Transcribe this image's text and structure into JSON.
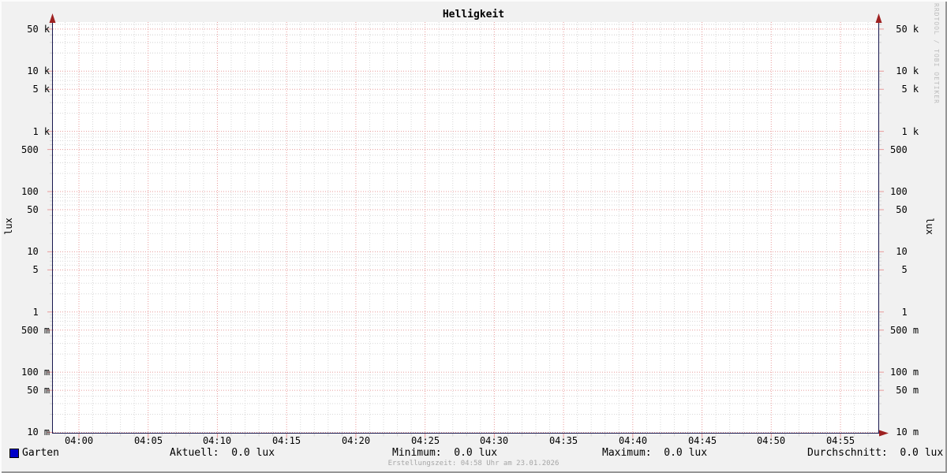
{
  "title": "Helligkeit",
  "watermark": "RRDTOOL / TOBI OETIKER",
  "footer": "Erstellungszeit: 04:58 Uhr am 23.01.2026",
  "y_axis_label": "lux",
  "legend": {
    "series": {
      "label": "Garten",
      "color": "#0000c8"
    },
    "stats": [
      {
        "label": "Aktuell:",
        "value": "0.0 lux"
      },
      {
        "label": "Minimum:",
        "value": "0.0 lux"
      },
      {
        "label": "Maximum:",
        "value": "0.0 lux"
      },
      {
        "label": "Durchschnitt:",
        "value": "0.0 lux"
      }
    ]
  },
  "chart_data": {
    "type": "line",
    "title": "Helligkeit",
    "xlabel": "",
    "ylabel": "lux",
    "y_scale": "log",
    "y_range": [
      0.01,
      65000
    ],
    "x_range": [
      "03:58",
      "04:58"
    ],
    "grid": true,
    "legend_position": "bottom",
    "y_major_ticks": [
      {
        "value": 50000,
        "label": " 50 k"
      },
      {
        "value": 10000,
        "label": " 10 k"
      },
      {
        "value": 5000,
        "label": "  5 k"
      },
      {
        "value": 1000,
        "label": "  1 k"
      },
      {
        "value": 500,
        "label": "500"
      },
      {
        "value": 100,
        "label": "100"
      },
      {
        "value": 50,
        "label": " 50"
      },
      {
        "value": 10,
        "label": " 10"
      },
      {
        "value": 5,
        "label": "  5"
      },
      {
        "value": 1,
        "label": "  1"
      },
      {
        "value": 0.5,
        "label": "500 m"
      },
      {
        "value": 0.1,
        "label": "100 m"
      },
      {
        "value": 0.05,
        "label": " 50 m"
      },
      {
        "value": 0.01,
        "label": " 10 m"
      }
    ],
    "y_minor_bases": [
      0.01,
      0.1,
      1,
      10,
      100,
      1000,
      10000
    ],
    "y_minor_multipliers": [
      2,
      3,
      4,
      6,
      7,
      8,
      9
    ],
    "y_minor_extra": [
      20000,
      30000,
      40000,
      60000
    ],
    "x_major_ticks": [
      {
        "minute": 240,
        "label": "04:00"
      },
      {
        "minute": 245,
        "label": "04:05"
      },
      {
        "minute": 250,
        "label": "04:10"
      },
      {
        "minute": 255,
        "label": "04:15"
      },
      {
        "minute": 260,
        "label": "04:20"
      },
      {
        "minute": 265,
        "label": "04:25"
      },
      {
        "minute": 270,
        "label": "04:30"
      },
      {
        "minute": 275,
        "label": "04:35"
      },
      {
        "minute": 280,
        "label": "04:40"
      },
      {
        "minute": 285,
        "label": "04:45"
      },
      {
        "minute": 290,
        "label": "04:50"
      },
      {
        "minute": 295,
        "label": "04:55"
      }
    ],
    "x_minor_step_minutes": 1,
    "x_minor_range_minutes": [
      239,
      297
    ],
    "series": [
      {
        "name": "Garten",
        "color": "#0000c8",
        "values": [],
        "stats": {
          "aktuell": 0.0,
          "minimum": 0.0,
          "maximum": 0.0,
          "durchschnitt": 0.0,
          "unit": "lux"
        }
      }
    ]
  },
  "colors": {
    "frame_bg": "#f1f1f1",
    "canvas_bg": "#ffffff",
    "grid_minor": "#d7d7d7",
    "grid_major": "#e89a9a",
    "axis": "#18184f",
    "arrow": "#9e2121",
    "text": "#000000",
    "footer_text": "#a6a6a6",
    "watermark_text": "#bdbdbd",
    "bevel_light": "#fbfbfb",
    "bevel_dark": "#969696",
    "legend_swatch": "#0000c8",
    "legend_swatch_border": "#000000"
  }
}
